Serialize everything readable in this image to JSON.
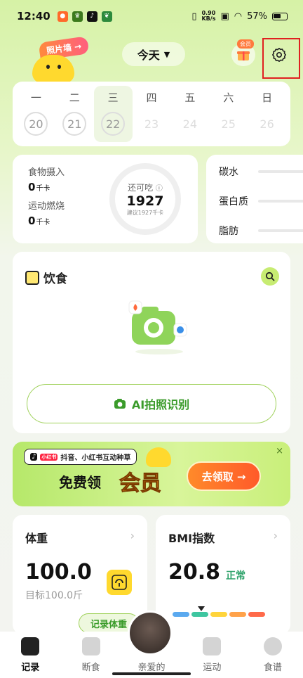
{
  "status_bar": {
    "time": "12:40",
    "net_speed_value": "0.90",
    "net_speed_unit": "KB/s",
    "battery": "57%"
  },
  "header": {
    "photo_wall": "照片墙 →",
    "date_label": "今天",
    "member_badge": "会员"
  },
  "week": [
    {
      "label": "一",
      "num": "20",
      "state": "past"
    },
    {
      "label": "二",
      "num": "21",
      "state": "past"
    },
    {
      "label": "三",
      "num": "22",
      "state": "today"
    },
    {
      "label": "四",
      "num": "23",
      "state": "future"
    },
    {
      "label": "五",
      "num": "24",
      "state": "future"
    },
    {
      "label": "六",
      "num": "25",
      "state": "future"
    },
    {
      "label": "日",
      "num": "26",
      "state": "future"
    }
  ],
  "calories": {
    "intake_label": "食物摄入",
    "intake_value": "0",
    "burn_label": "运动燃烧",
    "burn_value": "0",
    "unit": "千卡",
    "remaining_label": "还可吃",
    "remaining_value": "1927",
    "suggest": "建议1927千卡"
  },
  "macros": {
    "carbs": "碳水",
    "protein": "蛋白质",
    "fat": "脂肪"
  },
  "diet": {
    "title": "饮食",
    "ai_button": "AI拍照识别"
  },
  "banner": {
    "tag": "抖音、小红书互动种草",
    "free": "免费领",
    "member": "会员",
    "claim": "去领取 →",
    "close": "×"
  },
  "weight": {
    "title": "体重",
    "value": "100.0",
    "target": "目标100.0斤",
    "record": "记录体重"
  },
  "bmi": {
    "title": "BMI指数",
    "value": "20.8",
    "status": "正常",
    "segment_colors": [
      "#5aa9ef",
      "#3ec6a0",
      "#ffd43b",
      "#ffa24a",
      "#ff6a4a"
    ]
  },
  "nav": {
    "record": "记录",
    "fasting": "断食",
    "dear": "亲爱的",
    "exercise": "运动",
    "recipes": "食谱"
  },
  "colors": {
    "accent_green": "#3a9b2a",
    "highlight_red": "#e02020"
  }
}
